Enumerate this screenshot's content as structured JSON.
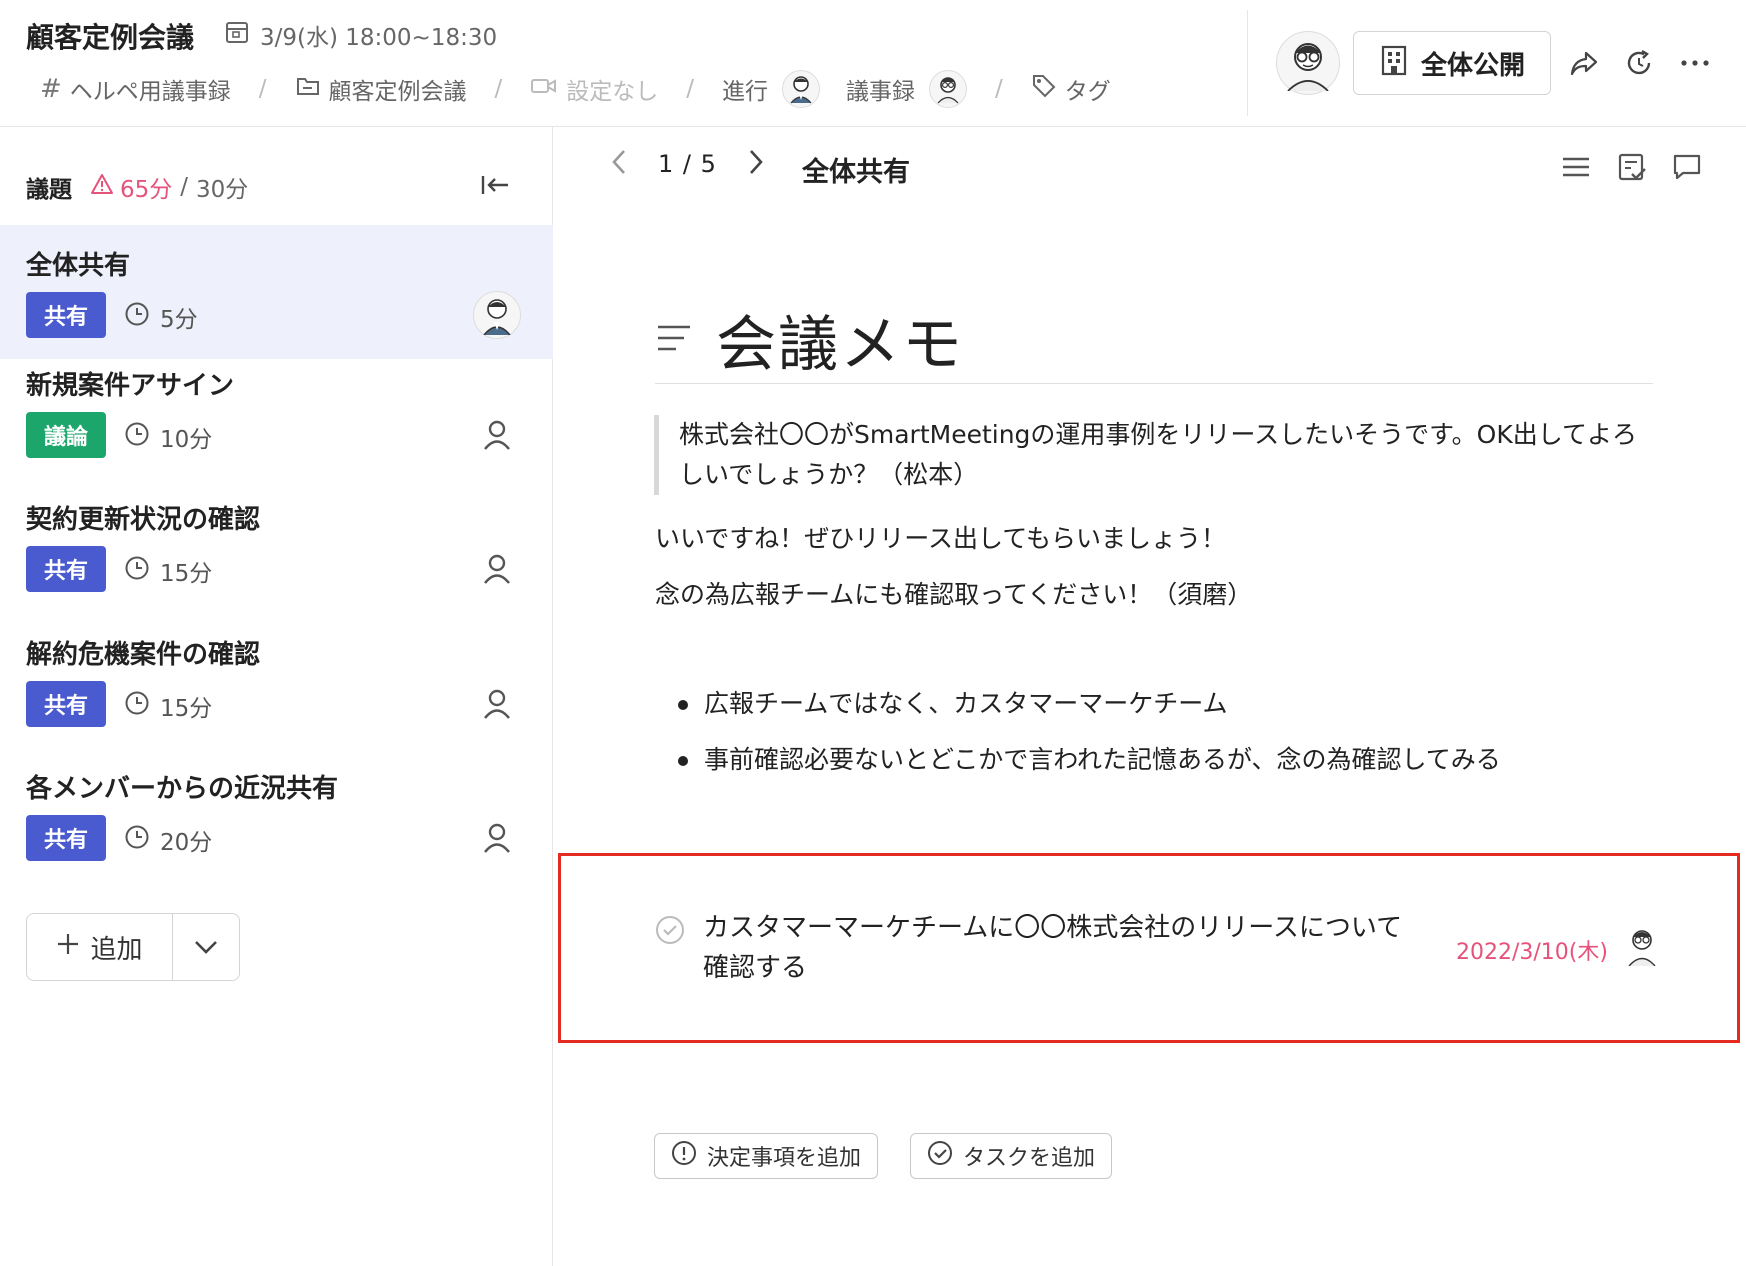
{
  "header": {
    "meeting_title": "顧客定例会議",
    "meeting_date": "3/9(水) 18:00~18:30",
    "breadcrumb": {
      "minutes_book": "ヘルペ用議事録",
      "meeting_series": "顧客定例会議",
      "video": "設定なし",
      "facilitator_label": "進行",
      "recorder_label": "議事録",
      "tag_label": "タグ"
    },
    "visibility_label": "全体公開"
  },
  "sidebar": {
    "agenda_label": "議題",
    "total_time": "65分",
    "separator": "/",
    "planned_time": "30分",
    "items": [
      {
        "title": "全体共有",
        "tag": "共有",
        "tag_color": "#4a5bd0",
        "duration": "5分",
        "active": true
      },
      {
        "title": "新規案件アサイン",
        "tag": "議論",
        "tag_color": "#1ca66b",
        "duration": "10分"
      },
      {
        "title": "契約更新状況の確認",
        "tag": "共有",
        "tag_color": "#4a5bd0",
        "duration": "15分"
      },
      {
        "title": "解約危機案件の確認",
        "tag": "共有",
        "tag_color": "#4a5bd0",
        "duration": "15分"
      },
      {
        "title": "各メンバーからの近況共有",
        "tag": "共有",
        "tag_color": "#4a5bd0",
        "duration": "20分"
      }
    ],
    "add_label": "追加"
  },
  "main": {
    "page_indicator": "1 / 5",
    "section_title": "全体共有",
    "memo_title": "会議メモ",
    "quote": "株式会社〇〇がSmartMeetingの運用事例をリリースしたいそうです。OK出してよろしいでしょうか？（松本）",
    "paragraphs": [
      "いいですね！ぜひリリース出してもらいましょう！",
      "念の為広報チームにも確認取ってください！（須磨）"
    ],
    "bullets": [
      "広報チームではなく、カスタマーマーケチーム",
      "事前確認必要ないとどこかで言われた記憶あるが、念の為確認してみる"
    ],
    "task": {
      "text": "カスタマーマーケチームに〇〇株式会社のリリースについて確認する",
      "due": "2022/3/10(木)",
      "due_color": "#e5527a"
    },
    "add_decision_label": "決定事項を追加",
    "add_task_label": "タスクを追加",
    "highlight_color": "#e52b1f"
  }
}
